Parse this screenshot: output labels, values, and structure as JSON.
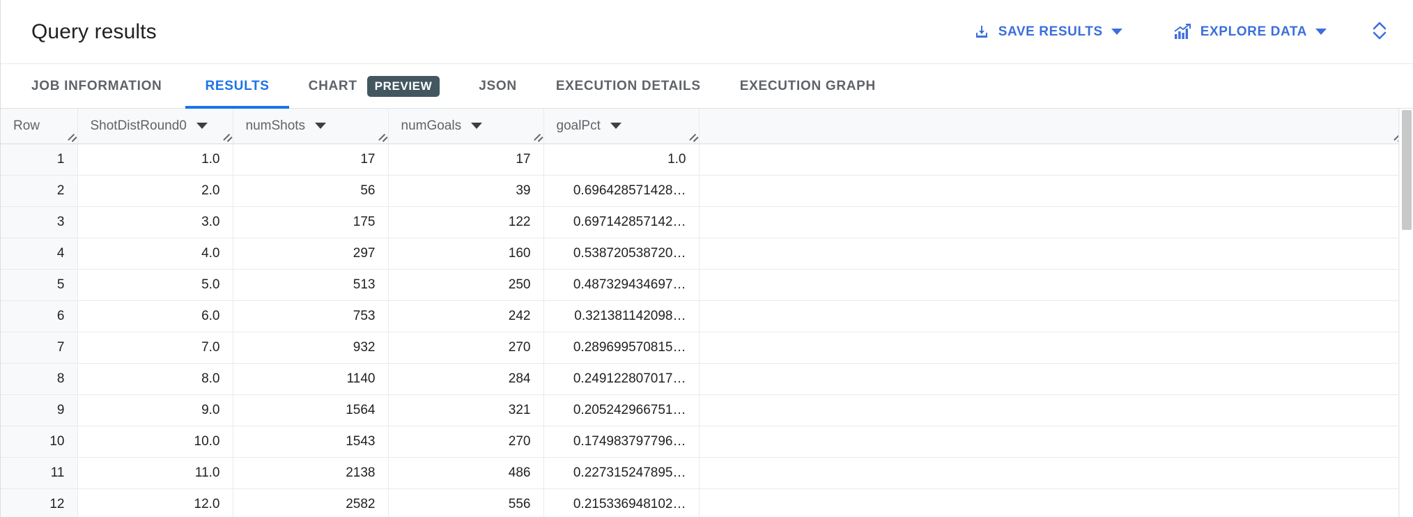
{
  "header": {
    "title": "Query results",
    "actions": [
      {
        "label": "SAVE RESULTS",
        "icon": "save-download-icon",
        "has_caret": true
      },
      {
        "label": "EXPLORE DATA",
        "icon": "bar-chart-trend-icon",
        "has_caret": true
      }
    ],
    "expand_icon": "expand-collapse-chevron-icon"
  },
  "tabs": [
    {
      "label": "JOB INFORMATION",
      "active": false,
      "badge": null
    },
    {
      "label": "RESULTS",
      "active": true,
      "badge": null
    },
    {
      "label": "CHART",
      "active": false,
      "badge": "PREVIEW"
    },
    {
      "label": "JSON",
      "active": false,
      "badge": null
    },
    {
      "label": "EXECUTION DETAILS",
      "active": false,
      "badge": null
    },
    {
      "label": "EXECUTION GRAPH",
      "active": false,
      "badge": null
    }
  ],
  "table": {
    "columns": [
      {
        "key": "row",
        "label": "Row",
        "menu": false
      },
      {
        "key": "a",
        "label": "ShotDistRound0",
        "menu": true
      },
      {
        "key": "b",
        "label": "numShots",
        "menu": true
      },
      {
        "key": "c",
        "label": "numGoals",
        "menu": true
      },
      {
        "key": "d",
        "label": "goalPct",
        "menu": true
      },
      {
        "key": "pad",
        "label": "",
        "menu": false
      }
    ],
    "rows": [
      {
        "row": "1",
        "a": "1.0",
        "b": "17",
        "c": "17",
        "d": "1.0"
      },
      {
        "row": "2",
        "a": "2.0",
        "b": "56",
        "c": "39",
        "d": "0.696428571428…"
      },
      {
        "row": "3",
        "a": "3.0",
        "b": "175",
        "c": "122",
        "d": "0.697142857142…"
      },
      {
        "row": "4",
        "a": "4.0",
        "b": "297",
        "c": "160",
        "d": "0.538720538720…"
      },
      {
        "row": "5",
        "a": "5.0",
        "b": "513",
        "c": "250",
        "d": "0.487329434697…"
      },
      {
        "row": "6",
        "a": "6.0",
        "b": "753",
        "c": "242",
        "d": "0.321381142098…"
      },
      {
        "row": "7",
        "a": "7.0",
        "b": "932",
        "c": "270",
        "d": "0.289699570815…"
      },
      {
        "row": "8",
        "a": "8.0",
        "b": "1140",
        "c": "284",
        "d": "0.249122807017…"
      },
      {
        "row": "9",
        "a": "9.0",
        "b": "1564",
        "c": "321",
        "d": "0.205242966751…"
      },
      {
        "row": "10",
        "a": "10.0",
        "b": "1543",
        "c": "270",
        "d": "0.174983797796…"
      },
      {
        "row": "11",
        "a": "11.0",
        "b": "2138",
        "c": "486",
        "d": "0.227315247895…"
      },
      {
        "row": "12",
        "a": "12.0",
        "b": "2582",
        "c": "556",
        "d": "0.215336948102…"
      }
    ]
  },
  "colors": {
    "accent_blue": "#1a73e8",
    "action_blue": "#3b6fdb",
    "preview_chip": "#435761",
    "row_header_bg": "#f8f9fa",
    "border": "#e8eaed",
    "scrollbar_thumb": "#c8c8c8"
  }
}
